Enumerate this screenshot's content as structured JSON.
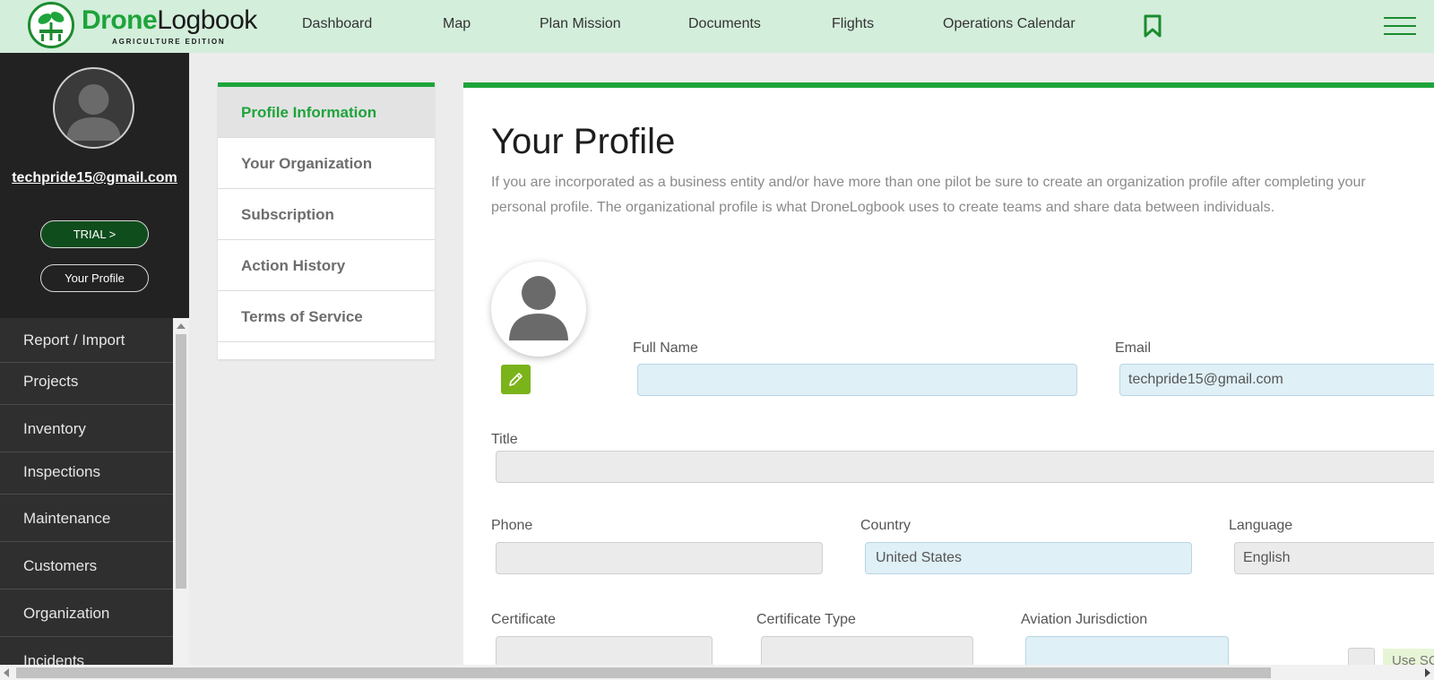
{
  "brand": {
    "name_bold": "Drone",
    "name_regular": "Logbook",
    "edition": "AGRICULTURE EDITION"
  },
  "nav": {
    "items": [
      "Dashboard",
      "Map",
      "Plan Mission",
      "Documents",
      "Flights",
      "Operations Calendar"
    ],
    "bookmark_icon": "bookmark-icon",
    "menu_icon": "hamburger-menu-icon"
  },
  "sidebar": {
    "user_email": "techpride15@gmail.com",
    "trial_button": "TRIAL >",
    "profile_button": "Your Profile",
    "menu": [
      "Report / Import",
      "Projects",
      "Inventory",
      "Inspections",
      "Maintenance",
      "Customers",
      "Organization",
      "Incidents"
    ]
  },
  "tabs": [
    "Profile Information",
    "Your Organization",
    "Subscription",
    "Action History",
    "Terms of Service"
  ],
  "profile": {
    "title": "Your Profile",
    "intro": "If you are incorporated as a business entity and/or have more than one pilot be sure to create an organization profile after completing your personal profile. The organizational profile is what DroneLogbook uses to create teams and share data between individuals.",
    "labels": {
      "full_name": "Full Name",
      "email": "Email",
      "title": "Title",
      "phone": "Phone",
      "country": "Country",
      "language": "Language",
      "certificate": "Certificate",
      "certificate_type": "Certificate Type",
      "aviation_jurisdiction": "Aviation Jurisdiction"
    },
    "values": {
      "full_name": "",
      "email": "techpride15@gmail.com",
      "title": "",
      "phone": "",
      "country": "United States",
      "language": "English",
      "certificate": "",
      "certificate_type": "",
      "aviation_jurisdiction": ""
    },
    "use_pill": "Use SC"
  },
  "colors": {
    "accent": "#1ea43b",
    "nav_bg": "#d3eedb",
    "sidebar_bg": "#2f2f2f",
    "trial_bg": "#0f4d1d",
    "edit_btn": "#7bb31a",
    "field_blue": "#dff0f7"
  }
}
